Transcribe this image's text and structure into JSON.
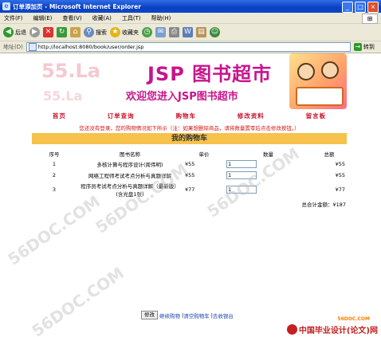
{
  "window": {
    "title": "订单添加页 - Microsoft Internet Explorer",
    "buttons": [
      "_",
      "□",
      "×"
    ]
  },
  "menubar": {
    "items": [
      "文件(F)",
      "编辑(E)",
      "查看(V)",
      "收藏(A)",
      "工具(T)",
      "帮助(H)"
    ]
  },
  "toolbar": {
    "back": "后退",
    "search": "搜索",
    "favorites": "收藏夹"
  },
  "address": {
    "label": "地址(D)",
    "url": "http://localhost:8080/book/user/order.jsp",
    "go": "转到"
  },
  "banner": {
    "title": "JSP 图书超市",
    "subtitle": "欢迎您进入JSP图书超市",
    "shadow1": "55.La",
    "shadow2": "55.La"
  },
  "nav": {
    "items": [
      "首页",
      "订单查询",
      "购物车",
      "修改资料",
      "留言板"
    ]
  },
  "notice": "您还没有登录，您的购物情况如下所示（注：如果想删除商品，请将数量置零后点击修改按钮。）",
  "cart": {
    "title": "我的购物车",
    "headers": [
      "序号",
      "图书名称",
      "单价",
      "数量",
      "总额"
    ],
    "rows": [
      {
        "seq": "1",
        "name": "多核计算与程序设计(周伟明)",
        "price": "¥55",
        "qty": "1",
        "total": "¥55"
      },
      {
        "seq": "2",
        "name": "网络工程师考试考点分析与真题详解",
        "price": "¥55",
        "qty": "1",
        "total": "¥55"
      },
      {
        "seq": "3",
        "name": "程序员考试考点分析与真题详解（最新版）(含光盘1张)",
        "price": "¥77",
        "qty": "1",
        "total": "¥77"
      }
    ],
    "sum_label": "总合计金额：¥187"
  },
  "footer": {
    "modify": "修改",
    "links": [
      "继续购物",
      "清空购物车",
      "去收银台"
    ]
  },
  "watermarks": [
    "56DOC.COM",
    "56DOC.COM",
    "56DOC.COM",
    "56DOC.COM"
  ],
  "brand": {
    "text": "中国毕业设计(论文)网",
    "site": "56DOC.COM"
  }
}
